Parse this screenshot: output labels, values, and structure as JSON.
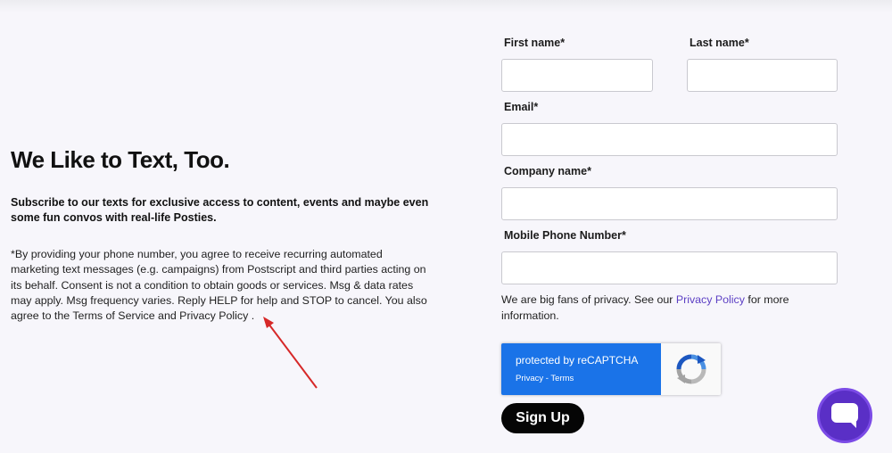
{
  "left": {
    "headline": "We Like to Text, Too.",
    "subhead": "Subscribe to our texts for exclusive access to content, events and maybe even some fun convos with real-life Posties.",
    "consent": "*By providing your phone number, you agree to receive recurring automated marketing text messages (e.g. campaigns) from Postscript and third parties acting on its behalf. Consent is not a condition to obtain goods or services. Msg & data rates may apply. Msg frequency varies. Reply HELP for help and STOP to cancel. You also agree to the Terms of Service and Privacy Policy ."
  },
  "form": {
    "first_name_label": "First name*",
    "first_name_value": "",
    "last_name_label": "Last name*",
    "last_name_value": "",
    "email_label": "Email*",
    "email_value": "",
    "company_label": "Company name*",
    "company_value": "",
    "phone_label": "Mobile Phone Number*",
    "phone_value": "",
    "privacy_prefix": "We are big fans of privacy. See our ",
    "privacy_link": "Privacy Policy",
    "privacy_suffix": " for more information.",
    "submit_label": "Sign Up"
  },
  "recaptcha": {
    "title": "protected by reCAPTCHA",
    "links": "Privacy - Terms",
    "icon": "recaptcha-logo-icon"
  },
  "chat_widget": {
    "icon": "chat-bubble-icon"
  },
  "annotation": {
    "icon": "red-arrow-icon",
    "color": "#d62828"
  },
  "colors": {
    "accent": "#5c3fc4",
    "recaptcha_blue": "#1a73e8",
    "button": "#050505",
    "chat": "#5a2fc6"
  }
}
